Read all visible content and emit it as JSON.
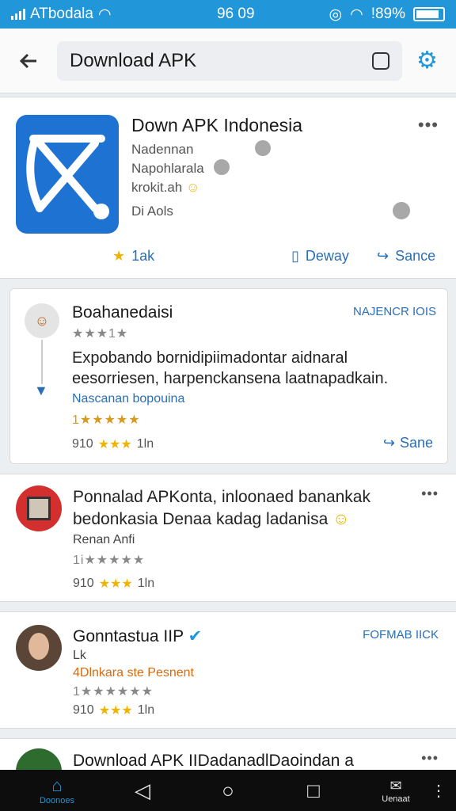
{
  "status": {
    "carrier": "ATbodala",
    "time": "96 09",
    "battery": "!89%"
  },
  "toolbar": {
    "search_value": "Download APK"
  },
  "app": {
    "title": "Down APK Indonesia",
    "line1": "Nadennan",
    "line2": "Napohlarala",
    "line3": "krokit.ah",
    "line4": "Di  Aols",
    "rating": "1ak",
    "action_download": "Deway",
    "action_share": "Sance"
  },
  "reviews": [
    {
      "name": "Boahanedaisi",
      "tag": "NAJENCR IOIS",
      "stars": "★★★1★",
      "body1": "Expobando bornidipiimadontar aidnaral",
      "body2": "eesorriesen, harpenckansena laatnapadkain.",
      "sub": "Nascanan bopouina",
      "sub_stars": "1★★★★★",
      "foot_num": "910",
      "foot_stars": "★★★",
      "foot_label": "1ln",
      "share": "Sane"
    },
    {
      "name": "Ponnalad APKonta, inloonaed banankak",
      "body2": "bedonkasia Denaa kadag ladanisa",
      "sub": "Renan Anfi",
      "sub_stars": "1i★★★★★",
      "foot_num": "910",
      "foot_stars": "★★★",
      "foot_label": "1ln"
    },
    {
      "name": "Gonntastua IIP",
      "tag": "FOFMAB IICK",
      "sub": "Lk",
      "sub2": "4Dlnkara ste Pesnent",
      "sub_stars": "1★★★★★★",
      "foot_num": "910",
      "foot_stars": "★★★",
      "foot_label": "1ln"
    },
    {
      "name": "Download APK",
      "name_tail": "IIDadanadlDaoindan  a"
    }
  ],
  "nav": {
    "home": "Doonoes",
    "recent": "Uenaat"
  },
  "colors": {
    "accent": "#2196d9",
    "star": "#f0b400",
    "link": "#2a6fb5"
  }
}
